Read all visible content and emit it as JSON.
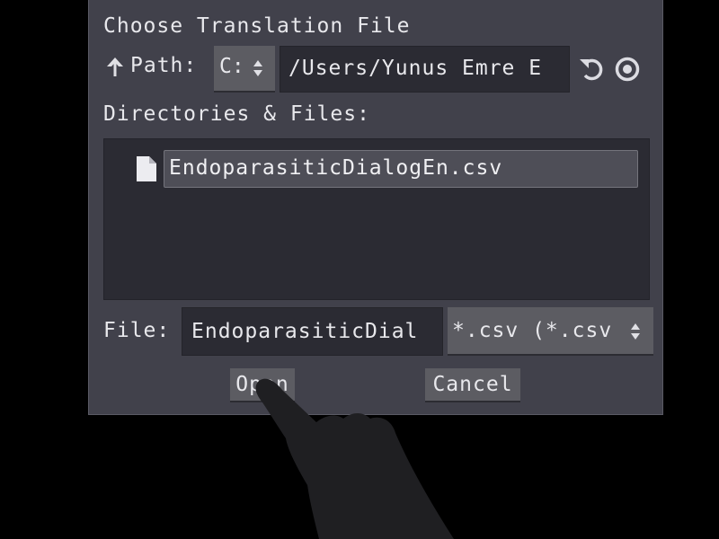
{
  "dialog": {
    "title": "Choose Translation File",
    "path_label": "Path:",
    "drive": "C:",
    "path_value": "/Users/Yunus Emre E",
    "dirs_label": "Directories & Files:",
    "files": [
      {
        "name": "EndoparasiticDialogEn.csv",
        "icon": "file-icon",
        "selected": true
      }
    ],
    "file_label": "File:",
    "file_value": "EndoparasiticDial",
    "filter": "*.csv (*.csv",
    "open_label": "Open",
    "cancel_label": "Cancel"
  },
  "icons": {
    "up": "arrow-up-icon",
    "refresh": "refresh-icon",
    "show_hidden": "eye-icon",
    "select": "updown-icon"
  },
  "colors": {
    "dialog_bg": "#41414b",
    "field_bg": "#2b2b33",
    "button_bg": "#5c5c62",
    "selected_bg": "#4e4e57",
    "text": "#e8e8ec"
  }
}
